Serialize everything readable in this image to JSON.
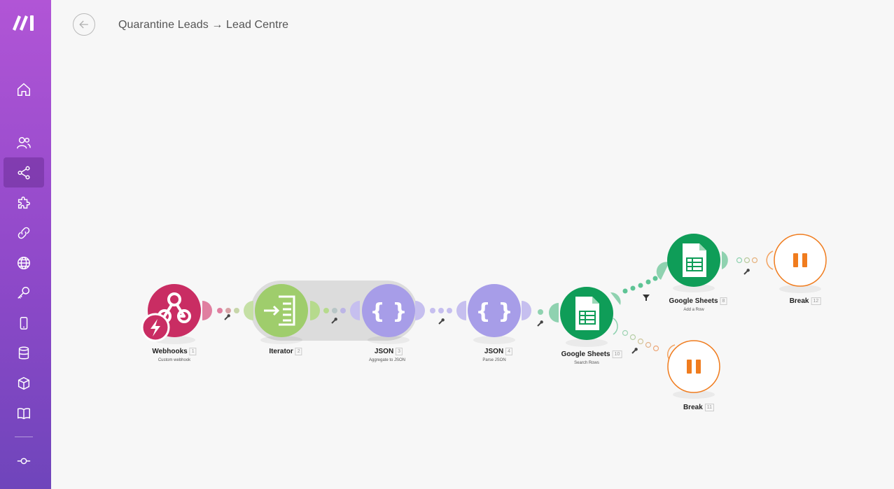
{
  "app": {
    "logo": "make-logo"
  },
  "header": {
    "back_icon": "arrow-left-icon",
    "breadcrumb": "Quarantine Leads → Lead Centre"
  },
  "sidebar": {
    "items": [
      {
        "name": "home",
        "icon": "home-icon"
      },
      {
        "name": "team",
        "icon": "users-icon"
      },
      {
        "name": "scenarios",
        "icon": "share-icon",
        "active": true
      },
      {
        "name": "templates",
        "icon": "puzzle-icon"
      },
      {
        "name": "connections",
        "icon": "link-icon"
      },
      {
        "name": "webhooks",
        "icon": "globe-icon"
      },
      {
        "name": "keys",
        "icon": "key-icon"
      },
      {
        "name": "devices",
        "icon": "mobile-icon"
      },
      {
        "name": "data-stores",
        "icon": "database-icon"
      },
      {
        "name": "data-structures",
        "icon": "cube-icon"
      },
      {
        "name": "documentation",
        "icon": "book-icon"
      },
      {
        "name": "settings",
        "icon": "commit-icon"
      }
    ]
  },
  "modules": [
    {
      "id": "webhooks",
      "title": "Webhooks",
      "num": "1",
      "subtitle": "Custom webhook",
      "color": "#c92d63",
      "icon": "webhook-icon"
    },
    {
      "id": "iterator",
      "title": "Iterator",
      "num": "2",
      "subtitle": "",
      "color": "#9fcd6c",
      "icon": "iterator-icon"
    },
    {
      "id": "json-aggregate",
      "title": "JSON",
      "num": "3",
      "subtitle": "Aggregate to JSON",
      "color": "#a79de8",
      "icon": "json-icon"
    },
    {
      "id": "json-parse",
      "title": "JSON",
      "num": "4",
      "subtitle": "Parse JSON",
      "color": "#a79de8",
      "icon": "json-icon"
    },
    {
      "id": "sheets-search",
      "title": "Google Sheets",
      "num": "10",
      "subtitle": "Search Rows",
      "color": "#0f9d58",
      "icon": "google-sheets-icon"
    },
    {
      "id": "sheets-add",
      "title": "Google Sheets",
      "num": "8",
      "subtitle": "Add a Row",
      "color": "#0f9d58",
      "icon": "google-sheets-icon"
    },
    {
      "id": "break-top",
      "title": "Break",
      "num": "12",
      "subtitle": "",
      "color": "#f07c1e",
      "icon": "pause-icon"
    },
    {
      "id": "break-bottom",
      "title": "Break",
      "num": "11",
      "subtitle": "",
      "color": "#f07c1e",
      "icon": "pause-icon"
    }
  ],
  "connectors": {
    "icons": [
      "wrench-icon",
      "filter-icon"
    ]
  },
  "colors": {
    "sidebar_top": "#b155d6",
    "sidebar_bottom": "#6f45bb",
    "webhook": "#c92d63",
    "iterator": "#9fcd6c",
    "json": "#a79de8",
    "sheets": "#0f9d58",
    "break": "#f07c1e"
  }
}
